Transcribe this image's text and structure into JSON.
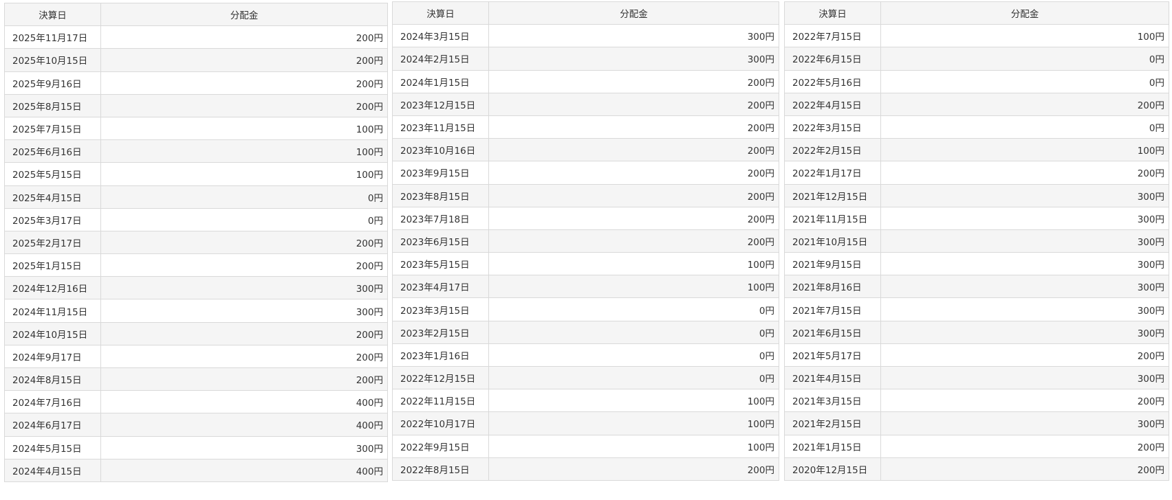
{
  "header": {
    "date_col": "決算日",
    "amount_col": "分配金"
  },
  "tables": [
    [
      [
        "2025年11月17日",
        "200円"
      ],
      [
        "2025年10月15日",
        "200円"
      ],
      [
        "2025年9月16日",
        "200円"
      ],
      [
        "2025年8月15日",
        "200円"
      ],
      [
        "2025年7月15日",
        "100円"
      ],
      [
        "2025年6月16日",
        "100円"
      ],
      [
        "2025年5月15日",
        "100円"
      ],
      [
        "2025年4月15日",
        "0円"
      ],
      [
        "2025年3月17日",
        "0円"
      ],
      [
        "2025年2月17日",
        "200円"
      ],
      [
        "2025年1月15日",
        "200円"
      ],
      [
        "2024年12月16日",
        "300円"
      ],
      [
        "2024年11月15日",
        "300円"
      ],
      [
        "2024年10月15日",
        "200円"
      ],
      [
        "2024年9月17日",
        "200円"
      ],
      [
        "2024年8月15日",
        "200円"
      ],
      [
        "2024年7月16日",
        "400円"
      ],
      [
        "2024年6月17日",
        "400円"
      ],
      [
        "2024年5月15日",
        "300円"
      ],
      [
        "2024年4月15日",
        "400円"
      ]
    ],
    [
      [
        "2024年3月15日",
        "300円"
      ],
      [
        "2024年2月15日",
        "300円"
      ],
      [
        "2024年1月15日",
        "200円"
      ],
      [
        "2023年12月15日",
        "200円"
      ],
      [
        "2023年11月15日",
        "200円"
      ],
      [
        "2023年10月16日",
        "200円"
      ],
      [
        "2023年9月15日",
        "200円"
      ],
      [
        "2023年8月15日",
        "200円"
      ],
      [
        "2023年7月18日",
        "200円"
      ],
      [
        "2023年6月15日",
        "200円"
      ],
      [
        "2023年5月15日",
        "100円"
      ],
      [
        "2023年4月17日",
        "100円"
      ],
      [
        "2023年3月15日",
        "0円"
      ],
      [
        "2023年2月15日",
        "0円"
      ],
      [
        "2023年1月16日",
        "0円"
      ],
      [
        "2022年12月15日",
        "0円"
      ],
      [
        "2022年11月15日",
        "100円"
      ],
      [
        "2022年10月17日",
        "100円"
      ],
      [
        "2022年9月15日",
        "100円"
      ],
      [
        "2022年8月15日",
        "200円"
      ]
    ],
    [
      [
        "2022年7月15日",
        "100円"
      ],
      [
        "2022年6月15日",
        "0円"
      ],
      [
        "2022年5月16日",
        "0円"
      ],
      [
        "2022年4月15日",
        "200円"
      ],
      [
        "2022年3月15日",
        "0円"
      ],
      [
        "2022年2月15日",
        "100円"
      ],
      [
        "2022年1月17日",
        "200円"
      ],
      [
        "2021年12月15日",
        "300円"
      ],
      [
        "2021年11月15日",
        "300円"
      ],
      [
        "2021年10月15日",
        "300円"
      ],
      [
        "2021年9月15日",
        "300円"
      ],
      [
        "2021年8月16日",
        "300円"
      ],
      [
        "2021年7月15日",
        "300円"
      ],
      [
        "2021年6月15日",
        "300円"
      ],
      [
        "2021年5月17日",
        "200円"
      ],
      [
        "2021年4月15日",
        "300円"
      ],
      [
        "2021年3月15日",
        "200円"
      ],
      [
        "2021年2月15日",
        "300円"
      ],
      [
        "2021年1月15日",
        "200円"
      ],
      [
        "2020年12月15日",
        "200円"
      ]
    ]
  ]
}
